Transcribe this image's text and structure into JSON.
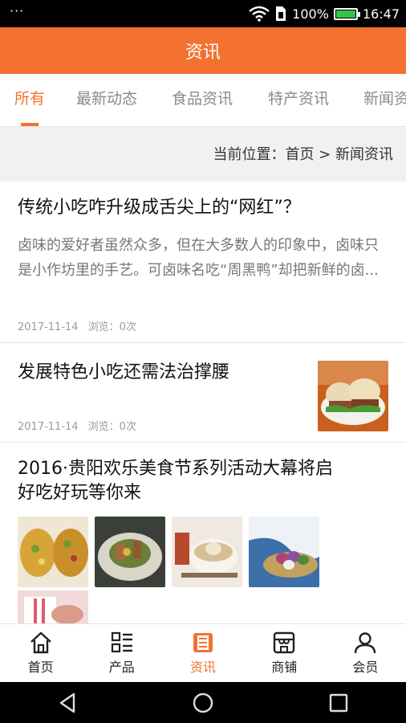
{
  "status_bar": {
    "menu_dots": "···",
    "battery": "100%",
    "time": "16:47",
    "battery_level": 1.0
  },
  "header": {
    "title": "资讯"
  },
  "tabs": [
    {
      "label": "所有",
      "active": true
    },
    {
      "label": "最新动态"
    },
    {
      "label": "食品资讯"
    },
    {
      "label": "特产资讯"
    },
    {
      "label": "新闻资讯"
    }
  ],
  "breadcrumb": {
    "text": "当前位置：首页 > 新闻资讯"
  },
  "articles": [
    {
      "title": "传统小吃咋升级成舌尖上的“网红”？",
      "summary": "卤味的爱好者虽然众多，但在大多数人的印象中，卤味只是小作坊里的手艺。可卤味名吃“周黑鸭”却把新鲜的卤...",
      "date": "2017-11-14",
      "views": "浏览：0次"
    },
    {
      "title": "发展特色小吃还需法治撑腰",
      "date": "2017-11-14",
      "views": "浏览：0次"
    },
    {
      "title_line1": "2016·贵阳欢乐美食节系列活动大幕将启",
      "title_line2": "好吃好玩等你来"
    }
  ],
  "bottom_nav": [
    {
      "label": "首页",
      "icon": "home-icon"
    },
    {
      "label": "产品",
      "icon": "list-grid-icon"
    },
    {
      "label": "资讯",
      "icon": "news-icon",
      "active": true
    },
    {
      "label": "商铺",
      "icon": "store-icon"
    },
    {
      "label": "会员",
      "icon": "user-icon"
    }
  ],
  "colors": {
    "accent": "#f47230",
    "active_tab": "#f47230"
  }
}
